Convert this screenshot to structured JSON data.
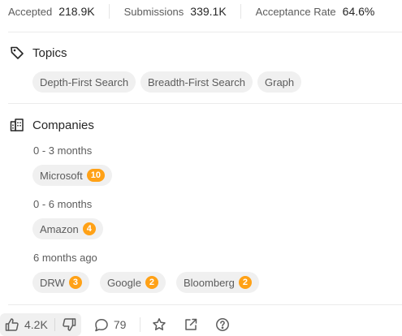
{
  "stats": {
    "accepted_label": "Accepted",
    "accepted_value": "218.9K",
    "submissions_label": "Submissions",
    "submissions_value": "339.1K",
    "acceptance_rate_label": "Acceptance Rate",
    "acceptance_rate_value": "64.6%"
  },
  "topics": {
    "title": "Topics",
    "icon": "tag-icon",
    "tags": [
      "Depth-First Search",
      "Breadth-First Search",
      "Graph"
    ]
  },
  "companies": {
    "title": "Companies",
    "icon": "building-icon",
    "groups": [
      {
        "period": "0 - 3 months",
        "items": [
          {
            "name": "Microsoft",
            "count": "10"
          }
        ]
      },
      {
        "period": "0 - 6 months",
        "items": [
          {
            "name": "Amazon",
            "count": "4"
          }
        ]
      },
      {
        "period": "6 months ago",
        "items": [
          {
            "name": "DRW",
            "count": "3"
          },
          {
            "name": "Google",
            "count": "2"
          },
          {
            "name": "Bloomberg",
            "count": "2"
          }
        ]
      }
    ]
  },
  "footer": {
    "likes": "4.2K",
    "comments": "79",
    "icons": [
      "thumbs-up-icon",
      "thumbs-down-icon",
      "comment-icon",
      "star-icon",
      "share-icon",
      "help-icon"
    ]
  },
  "colors": {
    "badge": "#ffa116",
    "chip_bg": "#f0f0f0",
    "muted_text": "#5c5c5c",
    "divider": "#ebebeb"
  }
}
